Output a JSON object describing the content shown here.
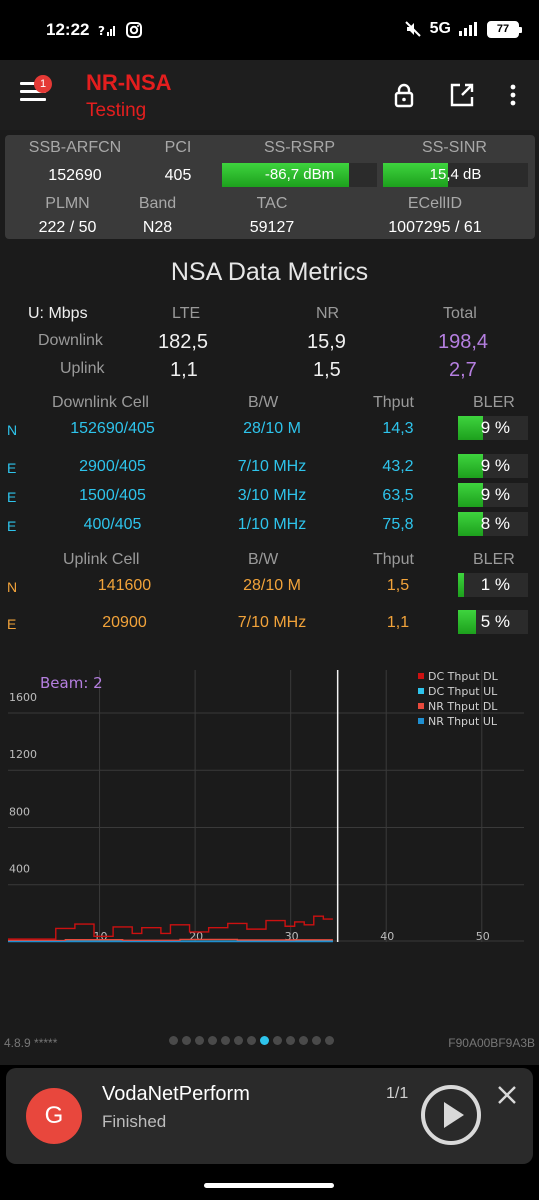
{
  "status_bar": {
    "time": "12:22",
    "network": "5G",
    "battery": "77"
  },
  "app_bar": {
    "notification_count": "1",
    "title": "NR-NSA",
    "subtitle": "Testing"
  },
  "cell_info": {
    "headers": [
      "SSB-ARFCN",
      "PCI",
      "SS-RSRP",
      "SS-SINR"
    ],
    "ssb_arfcn": "152690",
    "pci": "405",
    "ss_rsrp": "-86,7 dBm",
    "ss_rsrp_level": 0.82,
    "ss_sinr": "15,4 dB",
    "ss_sinr_level": 0.45,
    "headers2": [
      "PLMN",
      "Band",
      "TAC",
      "ECellID"
    ],
    "plmn": "222 / 50",
    "band": "N28",
    "tac": "59127",
    "ecellid": "1007295 / 61"
  },
  "metrics": {
    "title": "NSA Data Metrics",
    "unit_label": "U: Mbps",
    "col_lte": "LTE",
    "col_nr": "NR",
    "col_total": "Total",
    "downlink_label": "Downlink",
    "uplink_label": "Uplink",
    "dl_lte": "182,5",
    "dl_nr": "15,9",
    "dl_total": "198,4",
    "ul_lte": "1,1",
    "ul_nr": "1,5",
    "ul_total": "2,7"
  },
  "downlink_cells": {
    "headers": [
      "Downlink Cell",
      "B/W",
      "Thput",
      "BLER"
    ],
    "rows": [
      {
        "tech": "N",
        "cell": "152690/405",
        "bw": "28/10 M",
        "thput": "14,3",
        "bler": "9 %",
        "bler_level": 0.36
      },
      {
        "tech": "E",
        "cell": "2900/405",
        "bw": "7/10 MHz",
        "thput": "43,2",
        "bler": "9 %",
        "bler_level": 0.36
      },
      {
        "tech": "E",
        "cell": "1500/405",
        "bw": "3/10 MHz",
        "thput": "63,5",
        "bler": "9 %",
        "bler_level": 0.36
      },
      {
        "tech": "E",
        "cell": "400/405",
        "bw": "1/10 MHz",
        "thput": "75,8",
        "bler": "8 %",
        "bler_level": 0.36
      }
    ]
  },
  "uplink_cells": {
    "headers": [
      "Uplink Cell",
      "B/W",
      "Thput",
      "BLER"
    ],
    "rows": [
      {
        "tech": "N",
        "cell": "141600",
        "bw": "28/10 M",
        "thput": "1,5",
        "bler": "1 %",
        "bler_level": 0.08
      },
      {
        "tech": "E",
        "cell": "20900",
        "bw": "7/10 MHz",
        "thput": "1,1",
        "bler": "5 %",
        "bler_level": 0.26
      }
    ]
  },
  "chart_data": {
    "type": "line",
    "annotation": "Beam: 2",
    "yticks": [
      "400",
      "800",
      "1200",
      "1600"
    ],
    "xticks": [
      "10",
      "20",
      "30",
      "40",
      "50"
    ],
    "ylim": [
      0,
      1900
    ],
    "xlim": [
      0,
      54
    ],
    "legend_position": "top-right",
    "cursor_x": 34.5,
    "series": [
      {
        "name": "DC Thput DL",
        "color": "#cc1111",
        "x": [
          0,
          5,
          5,
          7,
          7,
          9,
          9,
          11,
          11,
          13,
          13,
          14,
          14,
          16,
          16,
          17,
          17,
          19,
          19,
          21,
          21,
          23,
          23,
          25,
          25,
          27,
          27,
          29,
          29,
          30,
          30,
          31,
          31,
          32,
          32,
          33,
          33,
          34
        ],
        "y": [
          20,
          20,
          95,
          95,
          125,
          125,
          40,
          40,
          105,
          105,
          60,
          60,
          100,
          100,
          60,
          60,
          120,
          120,
          70,
          70,
          100,
          100,
          130,
          130,
          90,
          90,
          150,
          150,
          110,
          110,
          140,
          140,
          120,
          120,
          180,
          180,
          160,
          160
        ]
      },
      {
        "name": "DC Thput UL",
        "color": "#2ec4ec",
        "x": [
          0,
          34
        ],
        "y": [
          6,
          6
        ]
      },
      {
        "name": "NR Thput DL",
        "color": "#e84a3c",
        "x": [
          0,
          6,
          6,
          12,
          12,
          18,
          18,
          24,
          24,
          30,
          30,
          34
        ],
        "y": [
          10,
          10,
          16,
          16,
          12,
          12,
          18,
          18,
          14,
          14,
          15,
          15
        ]
      },
      {
        "name": "NR Thput UL",
        "color": "#1f8fd0",
        "x": [
          0,
          34
        ],
        "y": [
          3,
          3
        ]
      }
    ]
  },
  "footer": {
    "version": "4.8.9 *****",
    "device_id": "F90A00BF9A3B",
    "page_count": 13,
    "active_page": 7
  },
  "media": {
    "avatar_letter": "G",
    "title": "VodaNetPerform",
    "subtitle": "Finished",
    "count": "1/1"
  }
}
